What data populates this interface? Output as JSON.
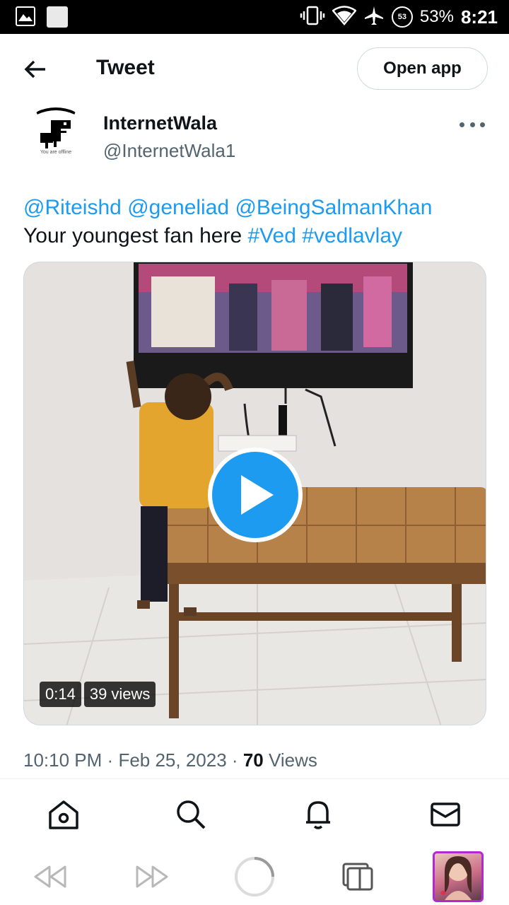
{
  "status_bar": {
    "battery_circle": "53",
    "battery": "53%",
    "time": "8:21"
  },
  "header": {
    "title": "Tweet",
    "open_app": "Open app"
  },
  "author": {
    "name": "InternetWala",
    "handle": "@InternetWala1",
    "avatar_caption": "You are offline"
  },
  "tweet": {
    "mentions": [
      "@Riteishd",
      "@geneliad",
      "@BeingSalmanKhan"
    ],
    "text": "Your youngest fan here",
    "hashtags": [
      "#Ved",
      "#vedlavlay"
    ]
  },
  "media": {
    "duration": "0:14",
    "views": "39 views"
  },
  "meta": {
    "time": "10:10 PM",
    "date": "Feb 25, 2023",
    "views_count": "70",
    "views_label": "Views"
  },
  "nav": [
    "home-icon",
    "search-icon",
    "bell-icon",
    "mail-icon"
  ],
  "browser": [
    "back-icon",
    "forward-icon",
    "loading-icon",
    "tabs-icon"
  ],
  "colors": {
    "accent": "#1d9bf0",
    "text": "#0f1419",
    "secondary": "#536471",
    "tab_border": "#b02acf"
  }
}
